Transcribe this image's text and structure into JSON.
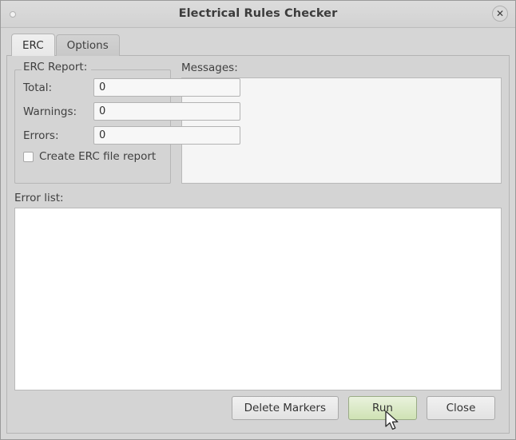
{
  "window": {
    "title": "Electrical Rules Checker",
    "close_icon": "close-icon",
    "close_glyph": "✕",
    "menu_dot": "window-dot-icon"
  },
  "tabs": [
    {
      "label": "ERC",
      "active": true
    },
    {
      "label": "Options",
      "active": false
    }
  ],
  "erc_report": {
    "group_title": "ERC Report:",
    "fields": [
      {
        "label": "Total:",
        "value": "0"
      },
      {
        "label": "Warnings:",
        "value": "0"
      },
      {
        "label": "Errors:",
        "value": "0"
      }
    ],
    "checkbox": {
      "label": "Create ERC file report",
      "checked": false
    }
  },
  "messages": {
    "label": "Messages:",
    "content": ""
  },
  "error_list": {
    "label": "Error list:",
    "content": ""
  },
  "footer": {
    "delete_markers_label": "Delete Markers",
    "run_label": "Run",
    "close_label": "Close"
  },
  "colors": {
    "window_bg": "#d6d6d6",
    "panel_bg": "#d4d4d4",
    "messages_bg": "#f5f5f5",
    "errorlist_bg": "#ffffff",
    "hover_green": "#cfe2b4",
    "text": "#3f3f3f"
  }
}
